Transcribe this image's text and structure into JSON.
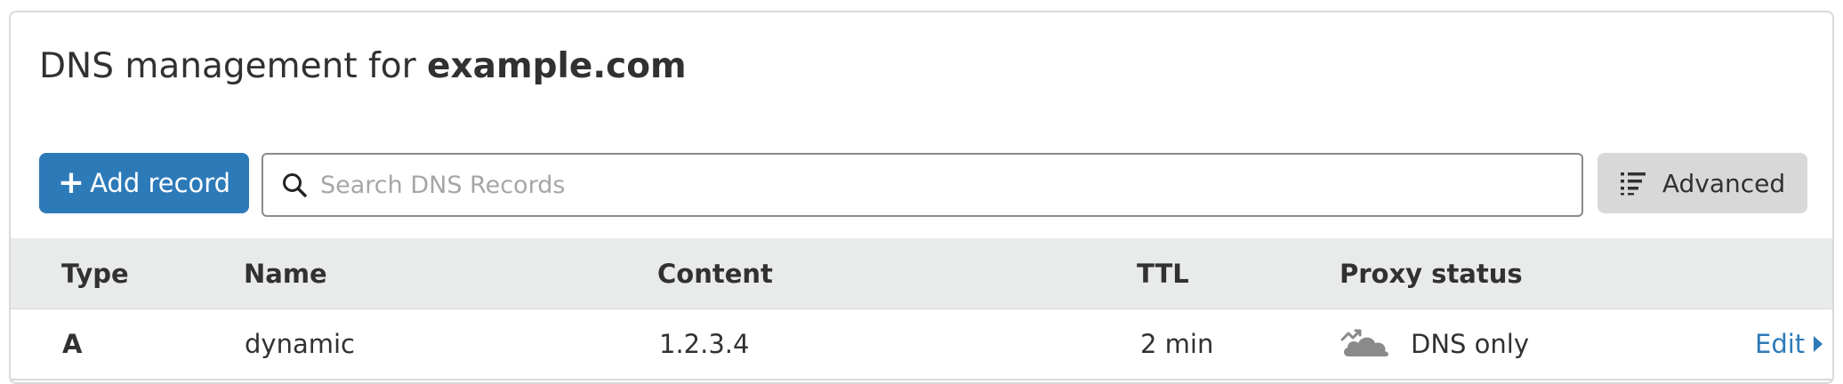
{
  "header": {
    "title_prefix": "DNS management for ",
    "domain": "example.com"
  },
  "toolbar": {
    "add_label": "Add record",
    "add_icon": "plus-icon",
    "search_placeholder": "Search DNS Records",
    "search_value": "",
    "advanced_label": "Advanced",
    "advanced_icon": "list-filter-icon"
  },
  "table": {
    "columns": [
      "Type",
      "Name",
      "Content",
      "TTL",
      "Proxy status"
    ],
    "rows": [
      {
        "type": "A",
        "name": "dynamic",
        "content": "1.2.3.4",
        "ttl": "2 min",
        "proxy_status": "DNS only",
        "proxy_icon": "grey-cloud-icon",
        "action_label": "Edit"
      }
    ]
  },
  "colors": {
    "primary": "#2d7ab9",
    "header_bg": "#e9ebeb",
    "secondary_button": "#d8d8d8",
    "text": "#313131",
    "placeholder": "#a6a6a6"
  }
}
